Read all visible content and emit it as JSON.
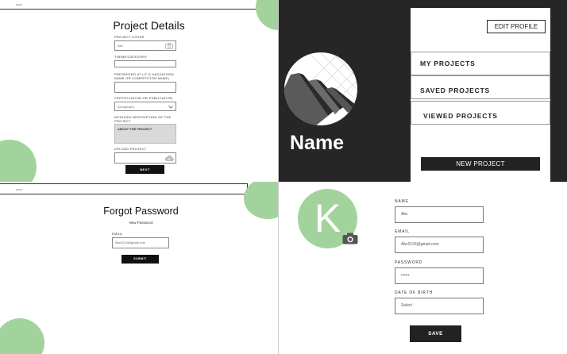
{
  "project_details": {
    "logo": "ooo",
    "title": "Project Details",
    "cover_label": "PROJECT COVER",
    "cover_value": "Abc",
    "theme_label": "THEME/CATEGORY",
    "presented_label": "PRESENTED AT ( E.G HACKATHON NAME OR COMPETITION NAME)",
    "cert_label": "CERTIFICATION OR PUBLICATION",
    "cert_value": "(Dropdown)",
    "desc_label": "DETAILED DESCRIPTION OF THE PROJECT",
    "desc_value": "ABOUT THE PROJECT",
    "upload_label": "UPLOAD PROJECT",
    "next_label": "NEXT"
  },
  "profile": {
    "name": "Name",
    "edit_label": "EDIT PROFILE",
    "menu": [
      "MY PROJECTS",
      "SAVED PROJECTS",
      "VIEWED PROJECTS"
    ],
    "new_project_label": "NEW PROJECT"
  },
  "forgot": {
    "logo": "ooo",
    "title": "Forgot Password",
    "subtitle": "New Password",
    "email_label": "EMAIL",
    "email_value": "Abc0124@gmail.com",
    "submit_label": "SUBMIT"
  },
  "edit_form": {
    "avatar_letter": "K",
    "name_label": "NAME",
    "name_value": "Abc",
    "email_label": "EMAIL",
    "email_value": "Abc0124@gmail.com",
    "password_label": "PASSWORD",
    "password_value": "••••••",
    "dob_label": "DATE OF BIRTH",
    "dob_value": "Select",
    "save_label": "SAVE"
  },
  "colors": {
    "accent_green": "#a3d39c",
    "dark_bg": "#262626",
    "button_dark": "#111111"
  },
  "icons": [
    "camera-icon",
    "upload-cloud-icon",
    "chevron-down-icon",
    "project-thumbnail-icon"
  ]
}
